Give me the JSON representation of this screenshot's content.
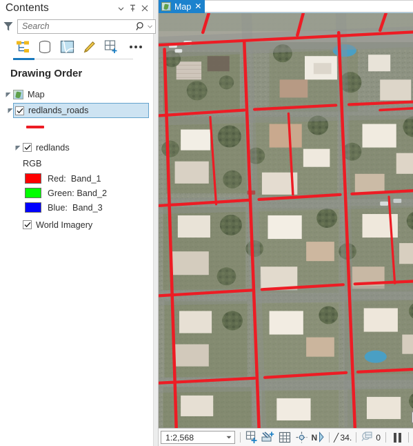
{
  "pane": {
    "title": "Contents",
    "header_buttons": [
      {
        "name": "menu-dropdown-icon",
        "glyph": "▾"
      },
      {
        "name": "pin-icon",
        "glyph": "⫶"
      },
      {
        "name": "close-icon",
        "glyph": "✕"
      }
    ],
    "filter_icon": "filter-funnel-icon",
    "search": {
      "placeholder": "Search",
      "value": "",
      "go_icon": "search-magnifier-icon",
      "caret_icon": "chevron-down-icon"
    },
    "toolbar": {
      "items": [
        {
          "label": "Drawing Order",
          "icon": "drawing-order-tree-icon",
          "active": true
        },
        {
          "label": "Data Source",
          "icon": "database-cylinder-icon",
          "active": false
        },
        {
          "label": "Selection",
          "icon": "map-selection-icon",
          "active": false
        },
        {
          "label": "Editing",
          "icon": "pencil-edit-icon",
          "active": false
        },
        {
          "label": "Snapping",
          "icon": "grid-add-icon",
          "active": false
        }
      ],
      "overflow_label": "More options",
      "overflow_icon": "ellipsis-icon"
    },
    "tree": {
      "heading": "Drawing Order",
      "map_node": {
        "label": "Map",
        "icon": "map-layer-icon",
        "expanded": true
      },
      "layers": [
        {
          "name": "redlands_roads",
          "checked": true,
          "selected": true,
          "expanded": true,
          "symbol_type": "line",
          "symbol_color": "#ED1C24"
        },
        {
          "name": "redlands",
          "checked": true,
          "selected": false,
          "expanded": true,
          "renderer_label": "RGB",
          "bands": [
            {
              "channel": "Red:",
              "band": "Band_1",
              "color": "#FF0000"
            },
            {
              "channel": "Green:",
              "band": "Band_2",
              "color": "#00FF00"
            },
            {
              "channel": "Blue:",
              "band": "Band_3",
              "color": "#0000FF"
            }
          ]
        },
        {
          "name": "World Imagery",
          "checked": true,
          "selected": false,
          "expanded": false
        }
      ]
    }
  },
  "map_view": {
    "tab": {
      "label": "Map",
      "close_glyph": "✕",
      "icon": "map-view-icon",
      "active": true,
      "accent_color": "#1C82CD"
    },
    "tabbar_overflow_icon": "chevron-down-icon",
    "basemap_description": "World Imagery aerial photo of a residential neighborhood in Redlands, California, with red road centerlines overlaid",
    "road_line_color": "#ED1C24",
    "popup_badge_icon": "attribute-popup-icon"
  },
  "statusbar": {
    "scale": {
      "value": "1:2,568",
      "caret_icon": "chevron-down-icon"
    },
    "buttons": [
      {
        "name": "selected-features-button",
        "icon": "grid-add-icon"
      },
      {
        "name": "measure-button",
        "icon": "measure-add-icon"
      },
      {
        "name": "show-grid-button",
        "icon": "grid-icon"
      },
      {
        "name": "map-center-button",
        "icon": "crosshair-icon"
      },
      {
        "name": "north-rotation-button",
        "icon": "north-arrow-icon"
      }
    ],
    "rotation": {
      "prefix": "╱",
      "value": "34.",
      "suffix": ""
    },
    "selection": {
      "icon": "zoom-to-selection-icon",
      "count": "0"
    },
    "pause_drawing": {
      "name": "pause-drawing-button",
      "icon": "pause-icon"
    },
    "refresh": {
      "name": "refresh-button",
      "icon": "refresh-icon",
      "color": "#2196C4"
    }
  }
}
